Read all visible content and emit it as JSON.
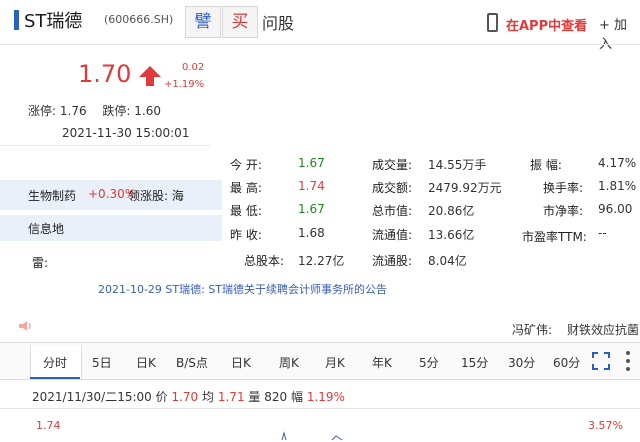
{
  "header": {
    "stock_name": "ST瑞德",
    "stock_code": "(600666.SH)",
    "fav_label": "譬",
    "buy_label": "买",
    "ask_label": "问股",
    "app_link": "在APP中查看",
    "add_label": "+ 加入"
  },
  "quote": {
    "price": "1.70",
    "change_abs": "0.02",
    "change_pct": "+1.19%",
    "limit_up_label": "涨停:",
    "limit_up": "1.76",
    "limit_down_label": "跌停:",
    "limit_down": "1.60",
    "timestamp": "2021-11-30 15:00:01"
  },
  "stats": {
    "open_label": "今 开:",
    "open": "1.67",
    "high_label": "最 高:",
    "high": "1.74",
    "low_label": "最 低:",
    "low": "1.67",
    "prev_label": "昨 收:",
    "prev": "1.68",
    "volume_label": "成交量:",
    "volume": "14.55万手",
    "amount_label": "成交额:",
    "amount": "2479.92万元",
    "total_mv_label": "总市值:",
    "total_mv": "20.86亿",
    "float_mv_label": "流通值:",
    "float_mv": "13.66亿",
    "total_shares_label": "总股本:",
    "total_shares": "12.27亿",
    "float_shares_label": "流通股:",
    "float_shares": "8.04亿",
    "amplitude_label": "振 幅:",
    "amplitude": "4.17%",
    "turnover_label": "换手率:",
    "turnover": "1.81%",
    "pb_label": "市净率:",
    "pb": "96.00",
    "pe_label": "市盈率TTM:",
    "pe": "--"
  },
  "sidebar": {
    "industry": "生物制药",
    "industry_chg": "+0.30%",
    "leader_label": "领涨股: 海",
    "info_label": "信息地",
    "reminder_label": "雷:"
  },
  "announcement": "2021-10-29  ST瑞德: ST瑞德关于续聘会计师事务所的公告",
  "news": {
    "label": "冯矿伟:",
    "text": "财铁效应抗菌"
  },
  "tabs": [
    "分时",
    "5日",
    "日K",
    "B/S点",
    "日K",
    "周K",
    "月K",
    "年K",
    "5分",
    "15分",
    "30分",
    "60分"
  ],
  "chart_info": {
    "datetime": "2021/11/30/二15:00",
    "price_label": "价",
    "price": "1.70",
    "avg_label": "均",
    "avg": "1.71",
    "vol_label": "量",
    "vol": "820",
    "amp_label": "幅",
    "amp": "1.19%"
  },
  "axis": {
    "left": "1.74",
    "right": "3.57%"
  },
  "colors": {
    "up": "#e03a3a",
    "down": "#1a8a1a",
    "accent": "#2b5fc7"
  }
}
